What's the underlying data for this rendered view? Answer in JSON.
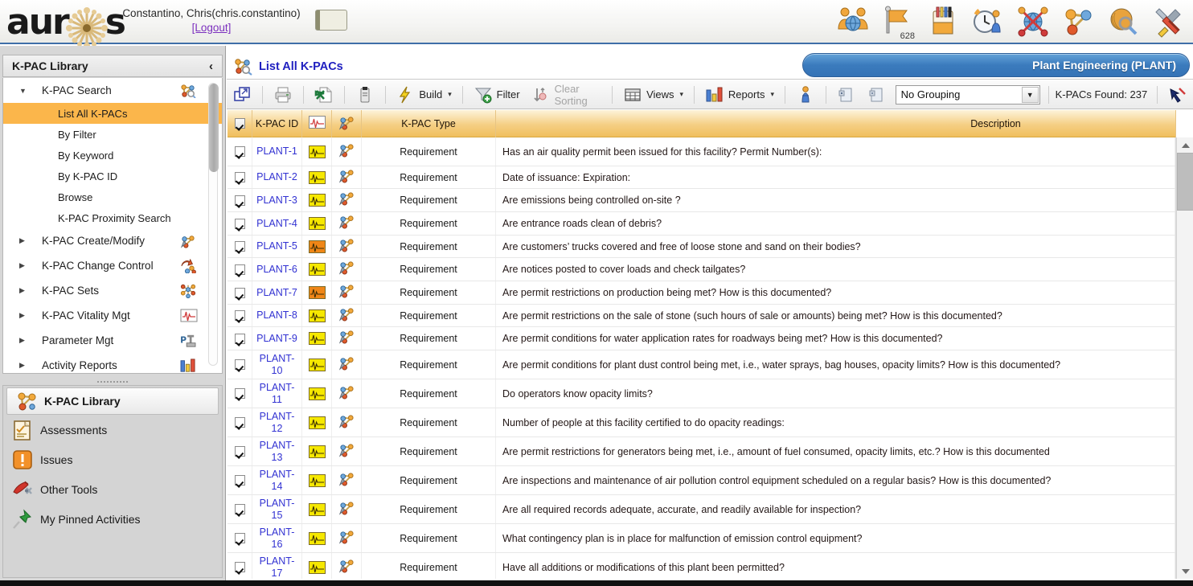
{
  "app": {
    "logo_text": "auros",
    "user_line": "Constantino, Chris(chris.constantino)",
    "logout_label": "[Logout]"
  },
  "top_icons": [
    {
      "name": "collaboration-icon",
      "label": "Collaboration"
    },
    {
      "name": "flag-icon",
      "label": "Flagged Items",
      "badge": "628"
    },
    {
      "name": "notebook-icon",
      "label": "Notebook"
    },
    {
      "name": "activity-clock-icon",
      "label": "My Activity"
    },
    {
      "name": "globe-network-icon",
      "label": "Network"
    },
    {
      "name": "kpac-node-icon",
      "label": "K-PACs"
    },
    {
      "name": "search-globe-icon",
      "label": "Search"
    },
    {
      "name": "tools-icon",
      "label": "Tools"
    }
  ],
  "sidebar": {
    "header_title": "K-PAC Library",
    "collapse_icon": "‹",
    "tree": [
      {
        "label": "K-PAC Search",
        "icon": "kpac-search-icon",
        "expanded": true,
        "children": [
          {
            "label": "List All K-PACs",
            "selected": true
          },
          {
            "label": "By Filter",
            "selected": false
          },
          {
            "label": "By Keyword",
            "selected": false
          },
          {
            "label": "By K-PAC ID",
            "selected": false
          },
          {
            "label": "Browse",
            "selected": false
          },
          {
            "label": "K-PAC Proximity Search",
            "selected": false
          }
        ]
      },
      {
        "label": "K-PAC Create/Modify",
        "icon": "kpac-create-icon",
        "expanded": false,
        "children": []
      },
      {
        "label": "K-PAC Change Control",
        "icon": "kpac-change-icon",
        "expanded": false,
        "children": []
      },
      {
        "label": "K-PAC Sets",
        "icon": "kpac-sets-icon",
        "expanded": false,
        "children": []
      },
      {
        "label": "K-PAC Vitality Mgt",
        "icon": "vitality-icon",
        "expanded": false,
        "children": []
      },
      {
        "label": "Parameter Mgt",
        "icon": "parameter-icon",
        "expanded": false,
        "children": []
      },
      {
        "label": "Activity Reports",
        "icon": "reports-icon",
        "expanded": false,
        "children": []
      }
    ],
    "nav": [
      {
        "label": "K-PAC Library",
        "icon": "kpac-library-icon",
        "active": true
      },
      {
        "label": "Assessments",
        "icon": "assessments-icon",
        "active": false
      },
      {
        "label": "Issues",
        "icon": "issues-icon",
        "active": false
      },
      {
        "label": "Other Tools",
        "icon": "other-tools-icon",
        "active": false
      },
      {
        "label": "My Pinned Activities",
        "icon": "pin-icon",
        "active": false
      }
    ]
  },
  "main": {
    "page_title": "List All K-PACs",
    "page_title_icon": "kpac-search-icon",
    "context_label": "Plant Engineering (PLANT)",
    "toolbar": {
      "popout_label": "",
      "print_label": "",
      "excel_label": "",
      "copy_label": "",
      "build_label": "Build",
      "filter_label": "Filter",
      "clear_sorting_label": "Clear Sorting",
      "views_label": "Views",
      "reports_label": "Reports",
      "person_label": "",
      "expand_label": "",
      "collapse_label": "",
      "grouping_value": "No Grouping",
      "found_label": "K-PACs Found: 237",
      "caret": "▾"
    },
    "columns": [
      {
        "key": "check",
        "label": "",
        "icon": "select-all-checkbox"
      },
      {
        "key": "id",
        "label": "K-PAC ID",
        "icon": ""
      },
      {
        "key": "vitality",
        "label": "",
        "icon": "vitality-icon"
      },
      {
        "key": "kpac",
        "label": "",
        "icon": "kpac-icon"
      },
      {
        "key": "type",
        "label": "K-PAC Type",
        "icon": ""
      },
      {
        "key": "description",
        "label": "Description",
        "icon": ""
      }
    ],
    "rows": [
      {
        "checked": true,
        "id": "PLANT-1",
        "vitality": "yellow",
        "type": "Requirement",
        "description": "Has an air quality permit been issued for this facility? Permit Number(s):"
      },
      {
        "checked": true,
        "id": "PLANT-2",
        "vitality": "yellow",
        "type": "Requirement",
        "description": "Date of issuance: Expiration:"
      },
      {
        "checked": true,
        "id": "PLANT-3",
        "vitality": "yellow",
        "type": "Requirement",
        "description": "Are emissions being controlled on-site ?"
      },
      {
        "checked": true,
        "id": "PLANT-4",
        "vitality": "yellow",
        "type": "Requirement",
        "description": "Are entrance roads clean of debris?"
      },
      {
        "checked": true,
        "id": "PLANT-5",
        "vitality": "orange",
        "type": "Requirement",
        "description": "Are customers’ trucks covered and free of loose stone and sand on their bodies?"
      },
      {
        "checked": true,
        "id": "PLANT-6",
        "vitality": "yellow",
        "type": "Requirement",
        "description": "Are notices posted to cover loads and check tailgates?"
      },
      {
        "checked": true,
        "id": "PLANT-7",
        "vitality": "orange",
        "type": "Requirement",
        "description": "Are permit restrictions on production being met? How is this documented?"
      },
      {
        "checked": true,
        "id": "PLANT-8",
        "vitality": "yellow",
        "type": "Requirement",
        "description": "Are permit restrictions on the sale of stone (such hours of sale or amounts) being met? How is this documented?"
      },
      {
        "checked": true,
        "id": "PLANT-9",
        "vitality": "yellow",
        "type": "Requirement",
        "description": "Are permit conditions for water application rates for roadways being met? How is this documented?"
      },
      {
        "checked": true,
        "id": "PLANT-10",
        "vitality": "yellow",
        "type": "Requirement",
        "description": "Are permit conditions for plant dust control being met, i.e., water sprays, bag houses, opacity limits? How is this documented?"
      },
      {
        "checked": true,
        "id": "PLANT-11",
        "vitality": "yellow",
        "type": "Requirement",
        "description": "Do operators know opacity limits?"
      },
      {
        "checked": true,
        "id": "PLANT-12",
        "vitality": "yellow",
        "type": "Requirement",
        "description": "Number of people at this facility certified to do opacity readings:"
      },
      {
        "checked": true,
        "id": "PLANT-13",
        "vitality": "yellow",
        "type": "Requirement",
        "description": "Are permit restrictions for generators being met, i.e., amount of fuel consumed, opacity limits, etc.? How is this documented"
      },
      {
        "checked": true,
        "id": "PLANT-14",
        "vitality": "yellow",
        "type": "Requirement",
        "description": "Are inspections and maintenance of air pollution control equipment scheduled on a regular basis? How is this documented?"
      },
      {
        "checked": true,
        "id": "PLANT-15",
        "vitality": "yellow",
        "type": "Requirement",
        "description": "Are all required records adequate, accurate, and readily available for inspection?"
      },
      {
        "checked": true,
        "id": "PLANT-16",
        "vitality": "yellow",
        "type": "Requirement",
        "description": "What contingency plan is in place for malfunction of emission control equipment?"
      },
      {
        "checked": true,
        "id": "PLANT-17",
        "vitality": "yellow",
        "type": "Requirement",
        "description": "Have all additions or modifications of this plant been permitted?"
      }
    ]
  },
  "colors": {
    "accent_blue": "#3573b6",
    "header_amber": "#f5cf84",
    "selection_orange": "#fbb64b",
    "link_blue": "#3232d2",
    "vitality_yellow": "#f6e800",
    "vitality_orange": "#ef8617"
  }
}
